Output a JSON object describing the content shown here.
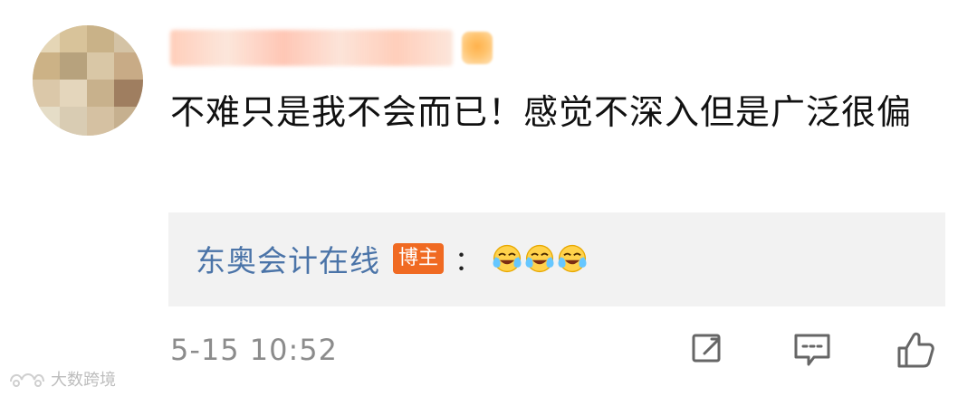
{
  "comment": {
    "username": "",
    "content": "不难只是我不会而已！感觉不深入但是广泛很偏",
    "time": "5-15 10:52"
  },
  "reply": {
    "author": "东奥会计在线",
    "badge": "博主",
    "colon": "：",
    "emojis": [
      "laugh-cry-emoji",
      "laugh-cry-emoji",
      "laugh-cry-emoji"
    ]
  },
  "actions": {
    "forward_icon": "forward-icon",
    "comment_icon": "comment-icon",
    "like_icon": "like-icon"
  },
  "watermark": {
    "text": "大数跨境"
  },
  "colors": {
    "primary_text": "#111111",
    "secondary_text": "#8c8c8c",
    "reply_author": "#4b74a8",
    "reply_background": "#f2f2f2",
    "badge_background": "#f06a22"
  }
}
